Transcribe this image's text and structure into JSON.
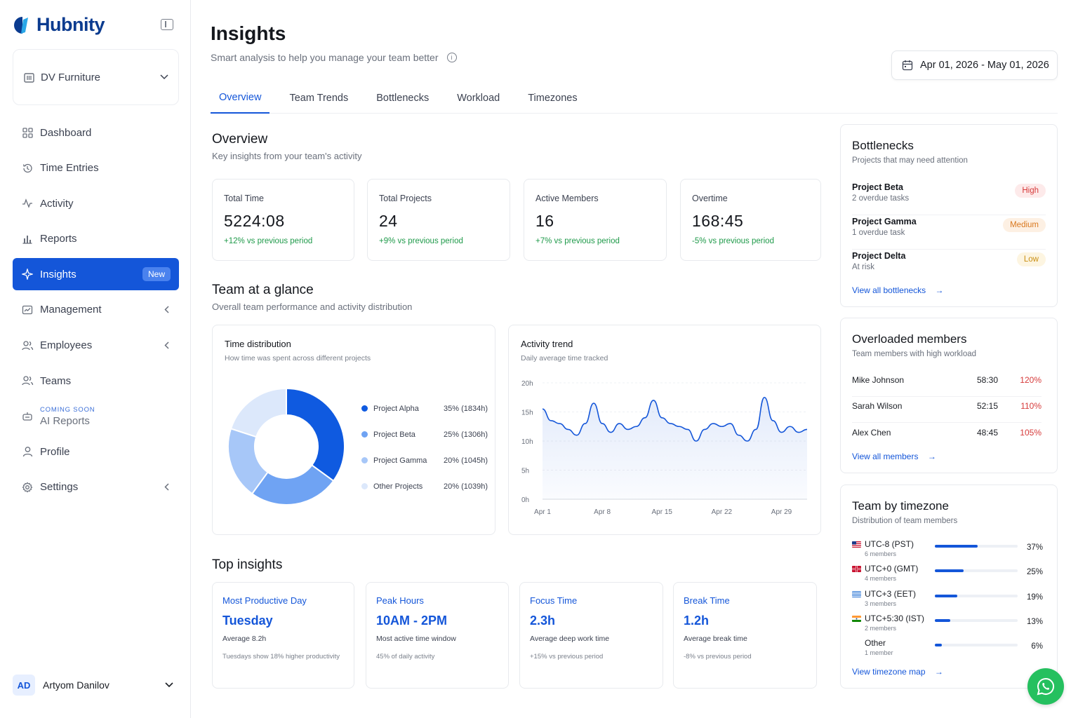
{
  "brand": {
    "name": "Hubnity",
    "accent": "#1456d9"
  },
  "org": {
    "label": "DV Furniture"
  },
  "nav": [
    {
      "label": "Dashboard",
      "icon": "grid-icon"
    },
    {
      "label": "Time Entries",
      "icon": "history-icon"
    },
    {
      "label": "Activity",
      "icon": "activity-icon"
    },
    {
      "label": "Reports",
      "icon": "bar-chart-icon"
    },
    {
      "label": "Insights",
      "icon": "sparkle-icon",
      "badge": "New",
      "active": true
    },
    {
      "label": "Management",
      "icon": "chart-window-icon"
    },
    {
      "label": "Employees",
      "icon": "users-icon"
    },
    {
      "label": "Teams",
      "icon": "team-icon"
    },
    {
      "label": "AI Reports",
      "icon": "robot-icon",
      "tag": "COMING SOON"
    },
    {
      "label": "Profile",
      "icon": "user-icon"
    },
    {
      "label": "Settings",
      "icon": "gear-icon"
    }
  ],
  "user": {
    "initials": "AD",
    "name": "Artyom Danilov"
  },
  "header": {
    "title": "Insights",
    "subtitle": "Smart analysis to help you manage your team better",
    "date_range": "Apr 01, 2026 - May 01, 2026"
  },
  "tabs": [
    "Overview",
    "Team Trends",
    "Bottlenecks",
    "Workload",
    "Timezones"
  ],
  "overview": {
    "title": "Overview",
    "subtitle": "Key insights from your team's activity",
    "stats": [
      {
        "label": "Total Time",
        "value": "5224:08",
        "delta": "+12% vs previous period"
      },
      {
        "label": "Total Projects",
        "value": "24",
        "delta": "+9% vs previous period"
      },
      {
        "label": "Active Members",
        "value": "16",
        "delta": "+7% vs previous period"
      },
      {
        "label": "Overtime",
        "value": "168:45",
        "delta": "-5% vs previous period"
      }
    ]
  },
  "glance": {
    "title": "Team at a glance",
    "subtitle": "Overall team performance and activity distribution"
  },
  "chart_data": [
    {
      "type": "pie",
      "title": "Time distribution",
      "subtitle": "How time was spent across different projects",
      "categories": [
        "Project Alpha",
        "Project Beta",
        "Project Gamma",
        "Other Projects"
      ],
      "values": [
        35,
        25,
        20,
        20
      ],
      "labels": [
        "35% (1834h)",
        "25% (1306h)",
        "20% (1045h)",
        "20% (1039h)"
      ],
      "colors": [
        "#0f5ae0",
        "#6fa3f3",
        "#a7c7f8",
        "#dce8fb"
      ]
    },
    {
      "type": "area",
      "title": "Activity trend",
      "subtitle": "Daily average time tracked",
      "y_ticks": [
        "20h",
        "15h",
        "10h",
        "5h",
        "0h"
      ],
      "x_ticks": [
        "Apr 1",
        "Apr 8",
        "Apr 15",
        "Apr 22",
        "Apr 29"
      ],
      "x_tick_days": [
        1,
        8,
        15,
        22,
        29
      ],
      "ylim": [
        0,
        20
      ],
      "xlim": [
        1,
        32
      ],
      "x": [
        1,
        2,
        3,
        4,
        5,
        6,
        7,
        8,
        9,
        10,
        11,
        12,
        13,
        14,
        15,
        16,
        17,
        18,
        19,
        20,
        21,
        22,
        23,
        24,
        25,
        26,
        27,
        28,
        29,
        30,
        31,
        32
      ],
      "values": [
        15.5,
        13.5,
        13,
        12,
        11,
        13,
        16.5,
        13,
        11.5,
        13,
        12,
        12.5,
        14,
        17,
        14,
        13,
        12.5,
        12,
        10,
        12,
        13,
        12.5,
        13,
        11,
        10,
        12,
        17.5,
        13.5,
        11.5,
        12.5,
        11.5,
        12
      ],
      "color": "#1456d9"
    }
  ],
  "top_insights": {
    "title": "Top insights",
    "items": [
      {
        "title": "Most Productive Day",
        "value": "Tuesday",
        "line1": "Average 8.2h",
        "line2": "Tuesdays show 18% higher productivity"
      },
      {
        "title": "Peak Hours",
        "value": "10AM - 2PM",
        "line1": "Most active time window",
        "line2": "45% of daily activity"
      },
      {
        "title": "Focus Time",
        "value": "2.3h",
        "line1": "Average deep work time",
        "line2": "+15% vs previous period"
      },
      {
        "title": "Break Time",
        "value": "1.2h",
        "line1": "Average break time",
        "line2": "-8% vs previous period"
      }
    ]
  },
  "bottlenecks": {
    "title": "Bottlenecks",
    "subtitle": "Projects that may need attention",
    "items": [
      {
        "name": "Project Beta",
        "desc": "2 overdue tasks",
        "level": "High",
        "color": "#d63a3a",
        "bg": "#fdeaea"
      },
      {
        "name": "Project Gamma",
        "desc": "1 overdue task",
        "level": "Medium",
        "color": "#d9781e",
        "bg": "#fdf0e3"
      },
      {
        "name": "Project Delta",
        "desc": "At risk",
        "level": "Low",
        "color": "#c98f14",
        "bg": "#fdf5e1"
      }
    ],
    "link": "View all bottlenecks"
  },
  "overloaded": {
    "title": "Overloaded members",
    "subtitle": "Team members with high workload",
    "items": [
      {
        "name": "Mike Johnson",
        "time": "58:30",
        "pct": "120%"
      },
      {
        "name": "Sarah Wilson",
        "time": "52:15",
        "pct": "110%"
      },
      {
        "name": "Alex Chen",
        "time": "48:45",
        "pct": "105%"
      }
    ],
    "link": "View all members"
  },
  "timezones": {
    "title": "Team by timezone",
    "subtitle": "Distribution of team members",
    "items": [
      {
        "label": "UTC-8 (PST)",
        "members": "6 members",
        "pct": "37%",
        "value": 37,
        "flag": "us"
      },
      {
        "label": "UTC+0 (GMT)",
        "members": "4 members",
        "pct": "25%",
        "value": 25,
        "flag": "gb"
      },
      {
        "label": "UTC+3 (EET)",
        "members": "3 members",
        "pct": "19%",
        "value": 19,
        "flag": "gr"
      },
      {
        "label": "UTC+5:30 (IST)",
        "members": "2 members",
        "pct": "13%",
        "value": 13,
        "flag": "in"
      },
      {
        "label": "Other",
        "members": "1 member",
        "pct": "6%",
        "value": 6,
        "flag": ""
      }
    ],
    "link": "View timezone map"
  }
}
